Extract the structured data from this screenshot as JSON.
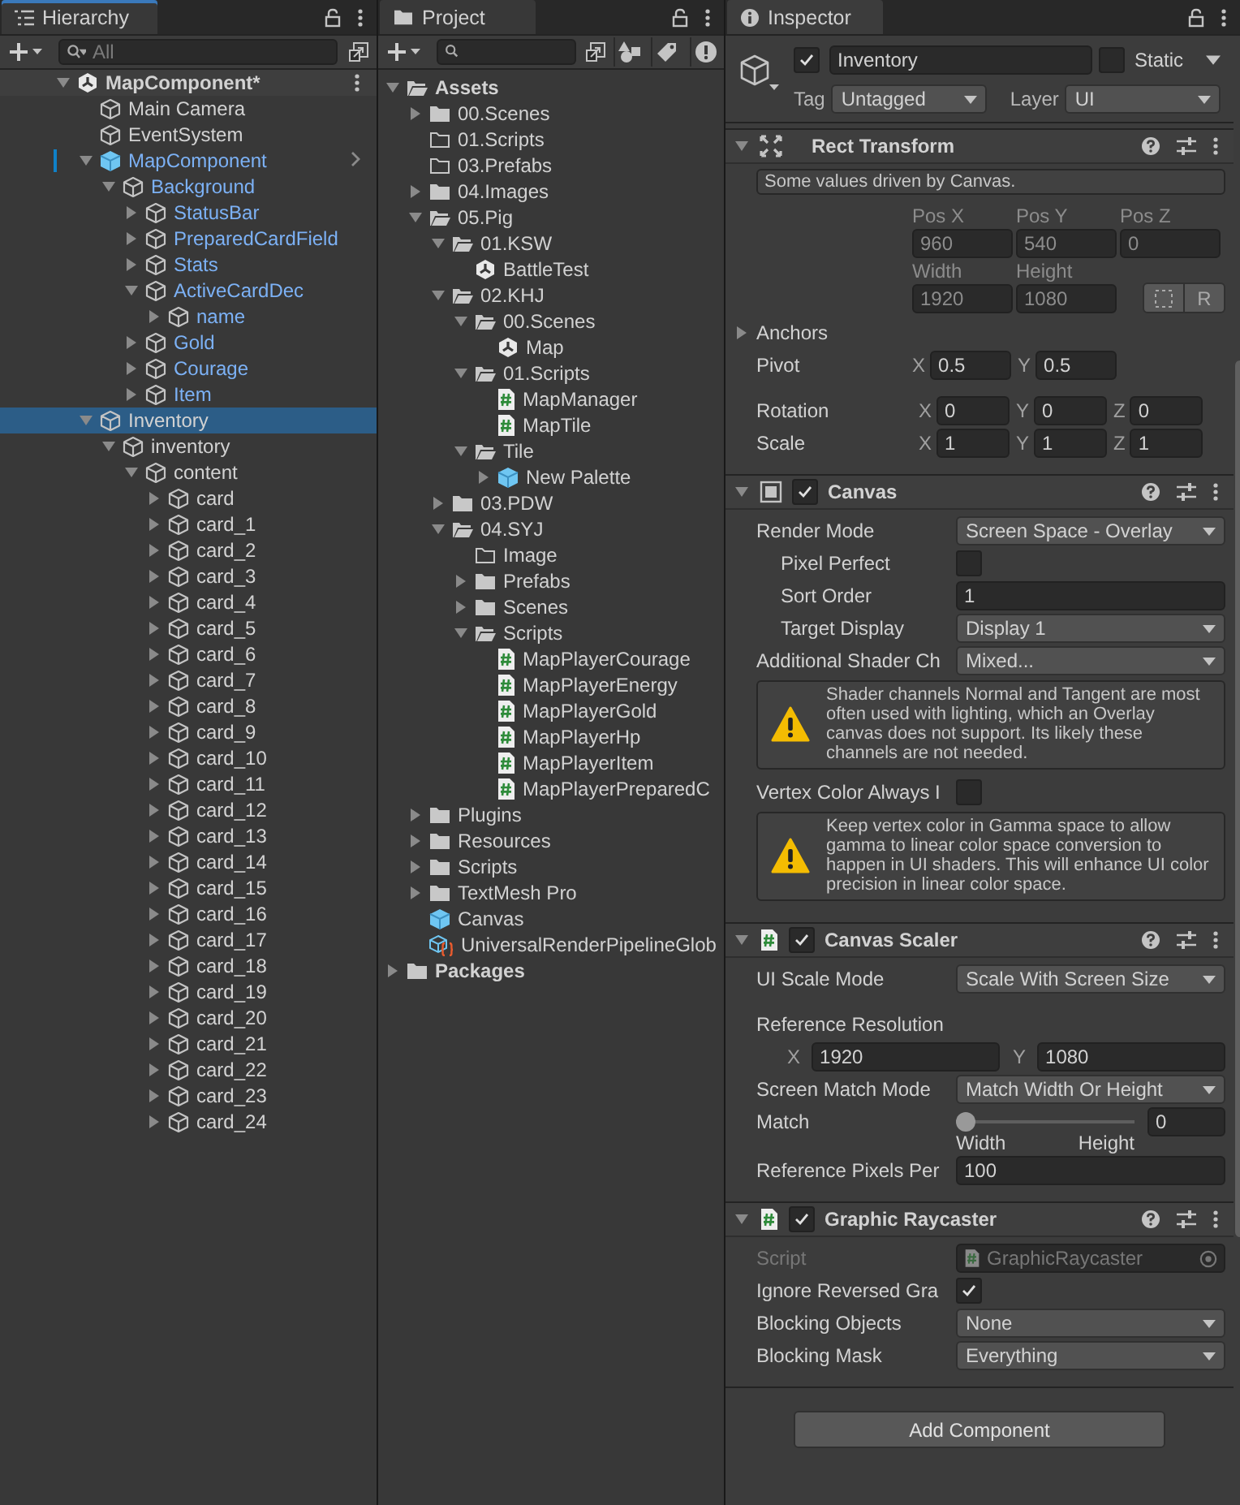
{
  "hierarchy": {
    "tab": "Hierarchy",
    "search": {
      "placeholder": "All"
    },
    "tree": [
      {
        "label": "MapComponent*",
        "kind": "scene",
        "prefab": false,
        "selected": false,
        "expanded": true,
        "children": [
          {
            "label": "Main Camera",
            "kind": "object",
            "prefab": false,
            "selected": false
          },
          {
            "label": "EventSystem",
            "kind": "object",
            "prefab": false,
            "selected": false
          },
          {
            "label": "MapComponent",
            "kind": "prefab",
            "prefab": true,
            "selected": false,
            "expanded": true,
            "children": [
              {
                "label": "Background",
                "kind": "object",
                "prefab": true,
                "selected": false,
                "expanded": true,
                "children": [
                  {
                    "label": "StatusBar",
                    "kind": "object",
                    "prefab": true,
                    "selected": false,
                    "expanded": false
                  },
                  {
                    "label": "PreparedCardField",
                    "kind": "object",
                    "prefab": true,
                    "selected": false,
                    "expanded": false
                  },
                  {
                    "label": "Stats",
                    "kind": "object",
                    "prefab": true,
                    "selected": false,
                    "expanded": false
                  },
                  {
                    "label": "ActiveCardDec",
                    "kind": "object",
                    "prefab": true,
                    "selected": false,
                    "expanded": true,
                    "children": [
                      {
                        "label": "name",
                        "kind": "object",
                        "prefab": true,
                        "selected": false,
                        "expanded": false
                      }
                    ]
                  },
                  {
                    "label": "Gold",
                    "kind": "object",
                    "prefab": true,
                    "selected": false,
                    "expanded": false
                  },
                  {
                    "label": "Courage",
                    "kind": "object",
                    "prefab": true,
                    "selected": false,
                    "expanded": false
                  },
                  {
                    "label": "Item",
                    "kind": "object",
                    "prefab": true,
                    "selected": false,
                    "expanded": false
                  }
                ]
              }
            ]
          },
          {
            "label": "Inventory",
            "kind": "object",
            "prefab": false,
            "selected": true,
            "expanded": true,
            "children": [
              {
                "label": "inventory",
                "kind": "object",
                "prefab": false,
                "selected": false,
                "expanded": true,
                "children": [
                  {
                    "label": "content",
                    "kind": "object",
                    "prefab": false,
                    "selected": false,
                    "expanded": true,
                    "children": [
                      {
                        "label": "card",
                        "kind": "object",
                        "prefab": false,
                        "selected": false,
                        "expanded": false
                      },
                      {
                        "label": "card_1",
                        "kind": "object",
                        "prefab": false,
                        "selected": false,
                        "expanded": false
                      },
                      {
                        "label": "card_2",
                        "kind": "object",
                        "prefab": false,
                        "selected": false,
                        "expanded": false
                      },
                      {
                        "label": "card_3",
                        "kind": "object",
                        "prefab": false,
                        "selected": false,
                        "expanded": false
                      },
                      {
                        "label": "card_4",
                        "kind": "object",
                        "prefab": false,
                        "selected": false,
                        "expanded": false
                      },
                      {
                        "label": "card_5",
                        "kind": "object",
                        "prefab": false,
                        "selected": false,
                        "expanded": false
                      },
                      {
                        "label": "card_6",
                        "kind": "object",
                        "prefab": false,
                        "selected": false,
                        "expanded": false
                      },
                      {
                        "label": "card_7",
                        "kind": "object",
                        "prefab": false,
                        "selected": false,
                        "expanded": false
                      },
                      {
                        "label": "card_8",
                        "kind": "object",
                        "prefab": false,
                        "selected": false,
                        "expanded": false
                      },
                      {
                        "label": "card_9",
                        "kind": "object",
                        "prefab": false,
                        "selected": false,
                        "expanded": false
                      },
                      {
                        "label": "card_10",
                        "kind": "object",
                        "prefab": false,
                        "selected": false,
                        "expanded": false
                      },
                      {
                        "label": "card_11",
                        "kind": "object",
                        "prefab": false,
                        "selected": false,
                        "expanded": false
                      },
                      {
                        "label": "card_12",
                        "kind": "object",
                        "prefab": false,
                        "selected": false,
                        "expanded": false
                      },
                      {
                        "label": "card_13",
                        "kind": "object",
                        "prefab": false,
                        "selected": false,
                        "expanded": false
                      },
                      {
                        "label": "card_14",
                        "kind": "object",
                        "prefab": false,
                        "selected": false,
                        "expanded": false
                      },
                      {
                        "label": "card_15",
                        "kind": "object",
                        "prefab": false,
                        "selected": false,
                        "expanded": false
                      },
                      {
                        "label": "card_16",
                        "kind": "object",
                        "prefab": false,
                        "selected": false,
                        "expanded": false
                      },
                      {
                        "label": "card_17",
                        "kind": "object",
                        "prefab": false,
                        "selected": false,
                        "expanded": false
                      },
                      {
                        "label": "card_18",
                        "kind": "object",
                        "prefab": false,
                        "selected": false,
                        "expanded": false
                      },
                      {
                        "label": "card_19",
                        "kind": "object",
                        "prefab": false,
                        "selected": false,
                        "expanded": false
                      },
                      {
                        "label": "card_20",
                        "kind": "object",
                        "prefab": false,
                        "selected": false,
                        "expanded": false
                      },
                      {
                        "label": "card_21",
                        "kind": "object",
                        "prefab": false,
                        "selected": false,
                        "expanded": false
                      },
                      {
                        "label": "card_22",
                        "kind": "object",
                        "prefab": false,
                        "selected": false,
                        "expanded": false
                      },
                      {
                        "label": "card_23",
                        "kind": "object",
                        "prefab": false,
                        "selected": false,
                        "expanded": false
                      },
                      {
                        "label": "card_24",
                        "kind": "object",
                        "prefab": false,
                        "selected": false,
                        "expanded": false
                      }
                    ]
                  }
                ]
              }
            ]
          }
        ]
      }
    ]
  },
  "project": {
    "tab": "Project",
    "tree": [
      {
        "label": "Assets",
        "kind": "folder",
        "selected": false,
        "expanded": true,
        "children": [
          {
            "label": "00.Scenes",
            "kind": "folder",
            "selected": false,
            "expanded": false
          },
          {
            "label": "01.Scripts",
            "kind": "empty_folder",
            "selected": false
          },
          {
            "label": "03.Prefabs",
            "kind": "empty_folder",
            "selected": false
          },
          {
            "label": "04.Images",
            "kind": "folder",
            "selected": false,
            "expanded": false
          },
          {
            "label": "05.Pig",
            "kind": "folder",
            "selected": false,
            "expanded": true,
            "children": [
              {
                "label": "01.KSW",
                "kind": "folder",
                "selected": false,
                "expanded": true,
                "children": [
                  {
                    "label": "BattleTest",
                    "kind": "scene",
                    "selected": false
                  }
                ]
              },
              {
                "label": "02.KHJ",
                "kind": "folder",
                "selected": false,
                "expanded": true,
                "children": [
                  {
                    "label": "00.Scenes",
                    "kind": "folder",
                    "selected": false,
                    "expanded": true,
                    "children": [
                      {
                        "label": "Map",
                        "kind": "scene",
                        "selected": false
                      }
                    ]
                  },
                  {
                    "label": "01.Scripts",
                    "kind": "folder",
                    "selected": false,
                    "expanded": true,
                    "children": [
                      {
                        "label": "MapManager",
                        "kind": "script",
                        "selected": false
                      },
                      {
                        "label": "MapTile",
                        "kind": "script",
                        "selected": false
                      }
                    ]
                  },
                  {
                    "label": "Tile",
                    "kind": "folder",
                    "selected": false,
                    "expanded": true,
                    "children": [
                      {
                        "label": "New Palette",
                        "kind": "prefab",
                        "selected": false,
                        "expanded": false
                      }
                    ]
                  }
                ]
              },
              {
                "label": "03.PDW",
                "kind": "folder",
                "selected": false,
                "expanded": false
              },
              {
                "label": "04.SYJ",
                "kind": "folder",
                "selected": false,
                "expanded": true,
                "children": [
                  {
                    "label": "Image",
                    "kind": "empty_folder",
                    "selected": false
                  },
                  {
                    "label": "Prefabs",
                    "kind": "folder",
                    "selected": false,
                    "expanded": false
                  },
                  {
                    "label": "Scenes",
                    "kind": "folder",
                    "selected": false,
                    "expanded": false
                  },
                  {
                    "label": "Scripts",
                    "kind": "folder",
                    "selected": false,
                    "expanded": true,
                    "children": [
                      {
                        "label": "MapPlayerCourage",
                        "kind": "script",
                        "selected": false
                      },
                      {
                        "label": "MapPlayerEnergy",
                        "kind": "script",
                        "selected": false
                      },
                      {
                        "label": "MapPlayerGold",
                        "kind": "script",
                        "selected": false
                      },
                      {
                        "label": "MapPlayerHp",
                        "kind": "script",
                        "selected": false
                      },
                      {
                        "label": "MapPlayerItem",
                        "kind": "script",
                        "selected": false
                      },
                      {
                        "label": "MapPlayerPreparedC",
                        "kind": "script",
                        "selected": false
                      }
                    ]
                  }
                ]
              }
            ]
          },
          {
            "label": "Plugins",
            "kind": "folder",
            "selected": false,
            "expanded": false
          },
          {
            "label": "Resources",
            "kind": "folder",
            "selected": false,
            "expanded": false
          },
          {
            "label": "Scripts",
            "kind": "folder",
            "selected": false,
            "expanded": false
          },
          {
            "label": "TextMesh Pro",
            "kind": "folder",
            "selected": false,
            "expanded": false
          },
          {
            "label": "Canvas",
            "kind": "prefab",
            "selected": false
          },
          {
            "label": "UniversalRenderPipelineGlob",
            "kind": "settings",
            "selected": false
          }
        ]
      },
      {
        "label": "Packages",
        "kind": "folder",
        "selected": false,
        "expanded": false
      }
    ]
  },
  "inspector": {
    "tab": "Inspector",
    "object": {
      "active": true,
      "name": "Inventory",
      "static": false,
      "static_label": "Static",
      "tag_label": "Tag",
      "tag": "Untagged",
      "layer_label": "Layer",
      "layer": "UI"
    },
    "rect_transform": {
      "title": "Rect Transform",
      "expanded": true,
      "driven": true,
      "note": "Some values driven by Canvas.",
      "position": [
        {
          "label": "Pos X",
          "value": "960"
        },
        {
          "label": "Pos Y",
          "value": "540"
        },
        {
          "label": "Pos Z",
          "value": "0"
        }
      ],
      "size": [
        {
          "label": "Width",
          "value": "1920"
        },
        {
          "label": "Height",
          "value": "1080"
        }
      ],
      "raw_button": "R",
      "anchors": {
        "label": "Anchors",
        "expanded": false
      },
      "pivot": {
        "label": "Pivot",
        "axes": [
          {
            "axis": "X",
            "value": "0.5"
          },
          {
            "axis": "Y",
            "value": "0.5"
          }
        ]
      },
      "rotation": {
        "label": "Rotation",
        "axes": [
          {
            "axis": "X",
            "value": "0"
          },
          {
            "axis": "Y",
            "value": "0"
          },
          {
            "axis": "Z",
            "value": "0"
          }
        ]
      },
      "scale": {
        "label": "Scale",
        "axes": [
          {
            "axis": "X",
            "value": "1"
          },
          {
            "axis": "Y",
            "value": "1"
          },
          {
            "axis": "Z",
            "value": "1"
          }
        ]
      }
    },
    "components": [
      {
        "title": "Canvas",
        "kind": "canvas",
        "enabled": true,
        "expanded": true,
        "props": [
          {
            "kind": "dropdown",
            "label": "Render Mode",
            "value": "Screen Space - Overlay"
          },
          {
            "kind": "checkbox",
            "label": "Pixel Perfect",
            "indent": true,
            "checked": false
          },
          {
            "kind": "input",
            "label": "Sort Order",
            "indent": true,
            "value": "1"
          },
          {
            "kind": "dropdown",
            "label": "Target Display",
            "indent": true,
            "value": "Display 1"
          },
          {
            "kind": "dropdown",
            "label": "Additional Shader Ch",
            "value": "Mixed..."
          },
          {
            "kind": "warning",
            "text": "Shader channels Normal and Tangent are most often used with lighting, which an Overlay canvas does not support. Its likely these channels are not needed."
          },
          {
            "kind": "checkbox",
            "label": "Vertex Color Always I",
            "checked": false
          },
          {
            "kind": "warning",
            "text": "Keep vertex color in Gamma space to allow gamma to linear color space conversion to happen in UI shaders. This will enhance UI color precision in linear color space."
          }
        ]
      },
      {
        "title": "Canvas Scaler",
        "kind": "script",
        "enabled": true,
        "expanded": true,
        "props": [
          {
            "kind": "dropdown",
            "label": "UI Scale Mode",
            "value": "Scale With Screen Size"
          },
          {
            "kind": "heading",
            "label": "Reference Resolution"
          },
          {
            "kind": "vector",
            "axes": [
              {
                "axis": "X",
                "value": "1920"
              },
              {
                "axis": "Y",
                "value": "1080"
              }
            ]
          },
          {
            "kind": "dropdown",
            "label": "Screen Match Mode",
            "value": "Match Width Or Height"
          },
          {
            "kind": "slider",
            "label": "Match",
            "level": 0,
            "value": "0",
            "min_label": "Width",
            "max_label": "Height"
          },
          {
            "kind": "input",
            "label": "Reference Pixels Per",
            "value": "100"
          }
        ]
      },
      {
        "title": "Graphic Raycaster",
        "kind": "script",
        "enabled": true,
        "expanded": true,
        "props": [
          {
            "kind": "object",
            "label": "Script",
            "disabled": true,
            "value": "GraphicRaycaster"
          },
          {
            "kind": "checkbox",
            "label": "Ignore Reversed Gra",
            "checked": true
          },
          {
            "kind": "dropdown",
            "label": "Blocking Objects",
            "value": "None"
          },
          {
            "kind": "dropdown",
            "label": "Blocking Mask",
            "value": "Everything"
          }
        ]
      }
    ],
    "add_button": "Add Component"
  }
}
